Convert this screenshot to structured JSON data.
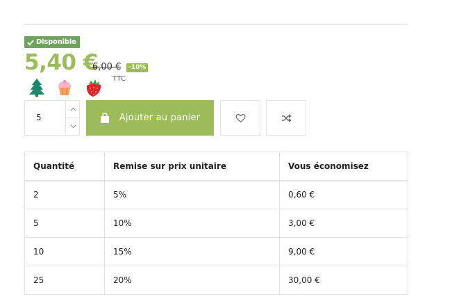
{
  "availability": {
    "label": "Disponible",
    "color": "#6fa35e"
  },
  "price": {
    "current": "5,40 €",
    "old": "6,00 €",
    "discount": "-10%",
    "tax_label": "TTC",
    "accent_color": "#9cbb5a"
  },
  "labels_icons": [
    "tree-icon",
    "cupcake-icon",
    "strawberry-icon"
  ],
  "purchase": {
    "quantity": "5",
    "add_to_cart": "Ajouter au panier"
  },
  "discount_table": {
    "headers": [
      "Quantité",
      "Remise sur prix unitaire",
      "Vous économisez"
    ],
    "rows": [
      [
        "2",
        "5%",
        "0,60 €"
      ],
      [
        "5",
        "10%",
        "3,00 €"
      ],
      [
        "10",
        "15%",
        "9,00 €"
      ],
      [
        "25",
        "20%",
        "30,00 €"
      ]
    ]
  }
}
